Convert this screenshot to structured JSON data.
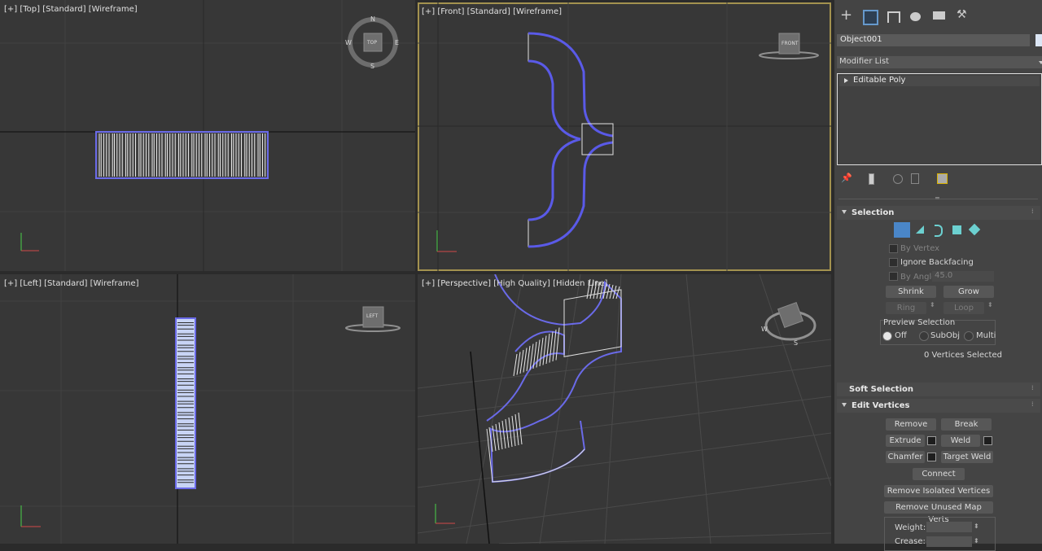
{
  "viewports": {
    "top": {
      "label": "[+] [Top] [Standard] [Wireframe]",
      "cube": "TOP",
      "n": "N",
      "s": "S",
      "e": "E",
      "w": "W"
    },
    "front": {
      "label": "[+] [Front] [Standard] [Wireframe]",
      "cube": "FRONT"
    },
    "left": {
      "label": "[+] [Left] [Standard] [Wireframe]",
      "cube": "LEFT"
    },
    "perspective": {
      "label": "[+] [Perspective] [High Quality] [Hidden Line]",
      "w": "W",
      "s": "S"
    }
  },
  "panel": {
    "object_name": "Object001",
    "object_color": "#dce6f5",
    "modifier_list": "Modifier List",
    "stack_item": "Editable Poly",
    "accent": "#4a86c8",
    "selection": {
      "title": "Selection",
      "by_vertex": "By Vertex",
      "ignore_backfacing": "Ignore Backfacing",
      "by_angle": "By Angle:",
      "angle_value": "45.0",
      "shrink": "Shrink",
      "grow": "Grow",
      "ring": "Ring",
      "loop": "Loop",
      "preview_selection": "Preview Selection",
      "off": "Off",
      "subobj": "SubObj",
      "multi": "Multi",
      "status": "0 Vertices Selected"
    },
    "soft_selection": {
      "title": "Soft Selection"
    },
    "edit_vertices": {
      "title": "Edit Vertices",
      "remove": "Remove",
      "break": "Break",
      "extrude": "Extrude",
      "weld": "Weld",
      "chamfer": "Chamfer",
      "target_weld": "Target Weld",
      "connect": "Connect",
      "remove_isolated": "Remove Isolated Vertices",
      "remove_unused": "Remove Unused Map Verts",
      "weight": "Weight:",
      "crease": "Crease:"
    }
  }
}
